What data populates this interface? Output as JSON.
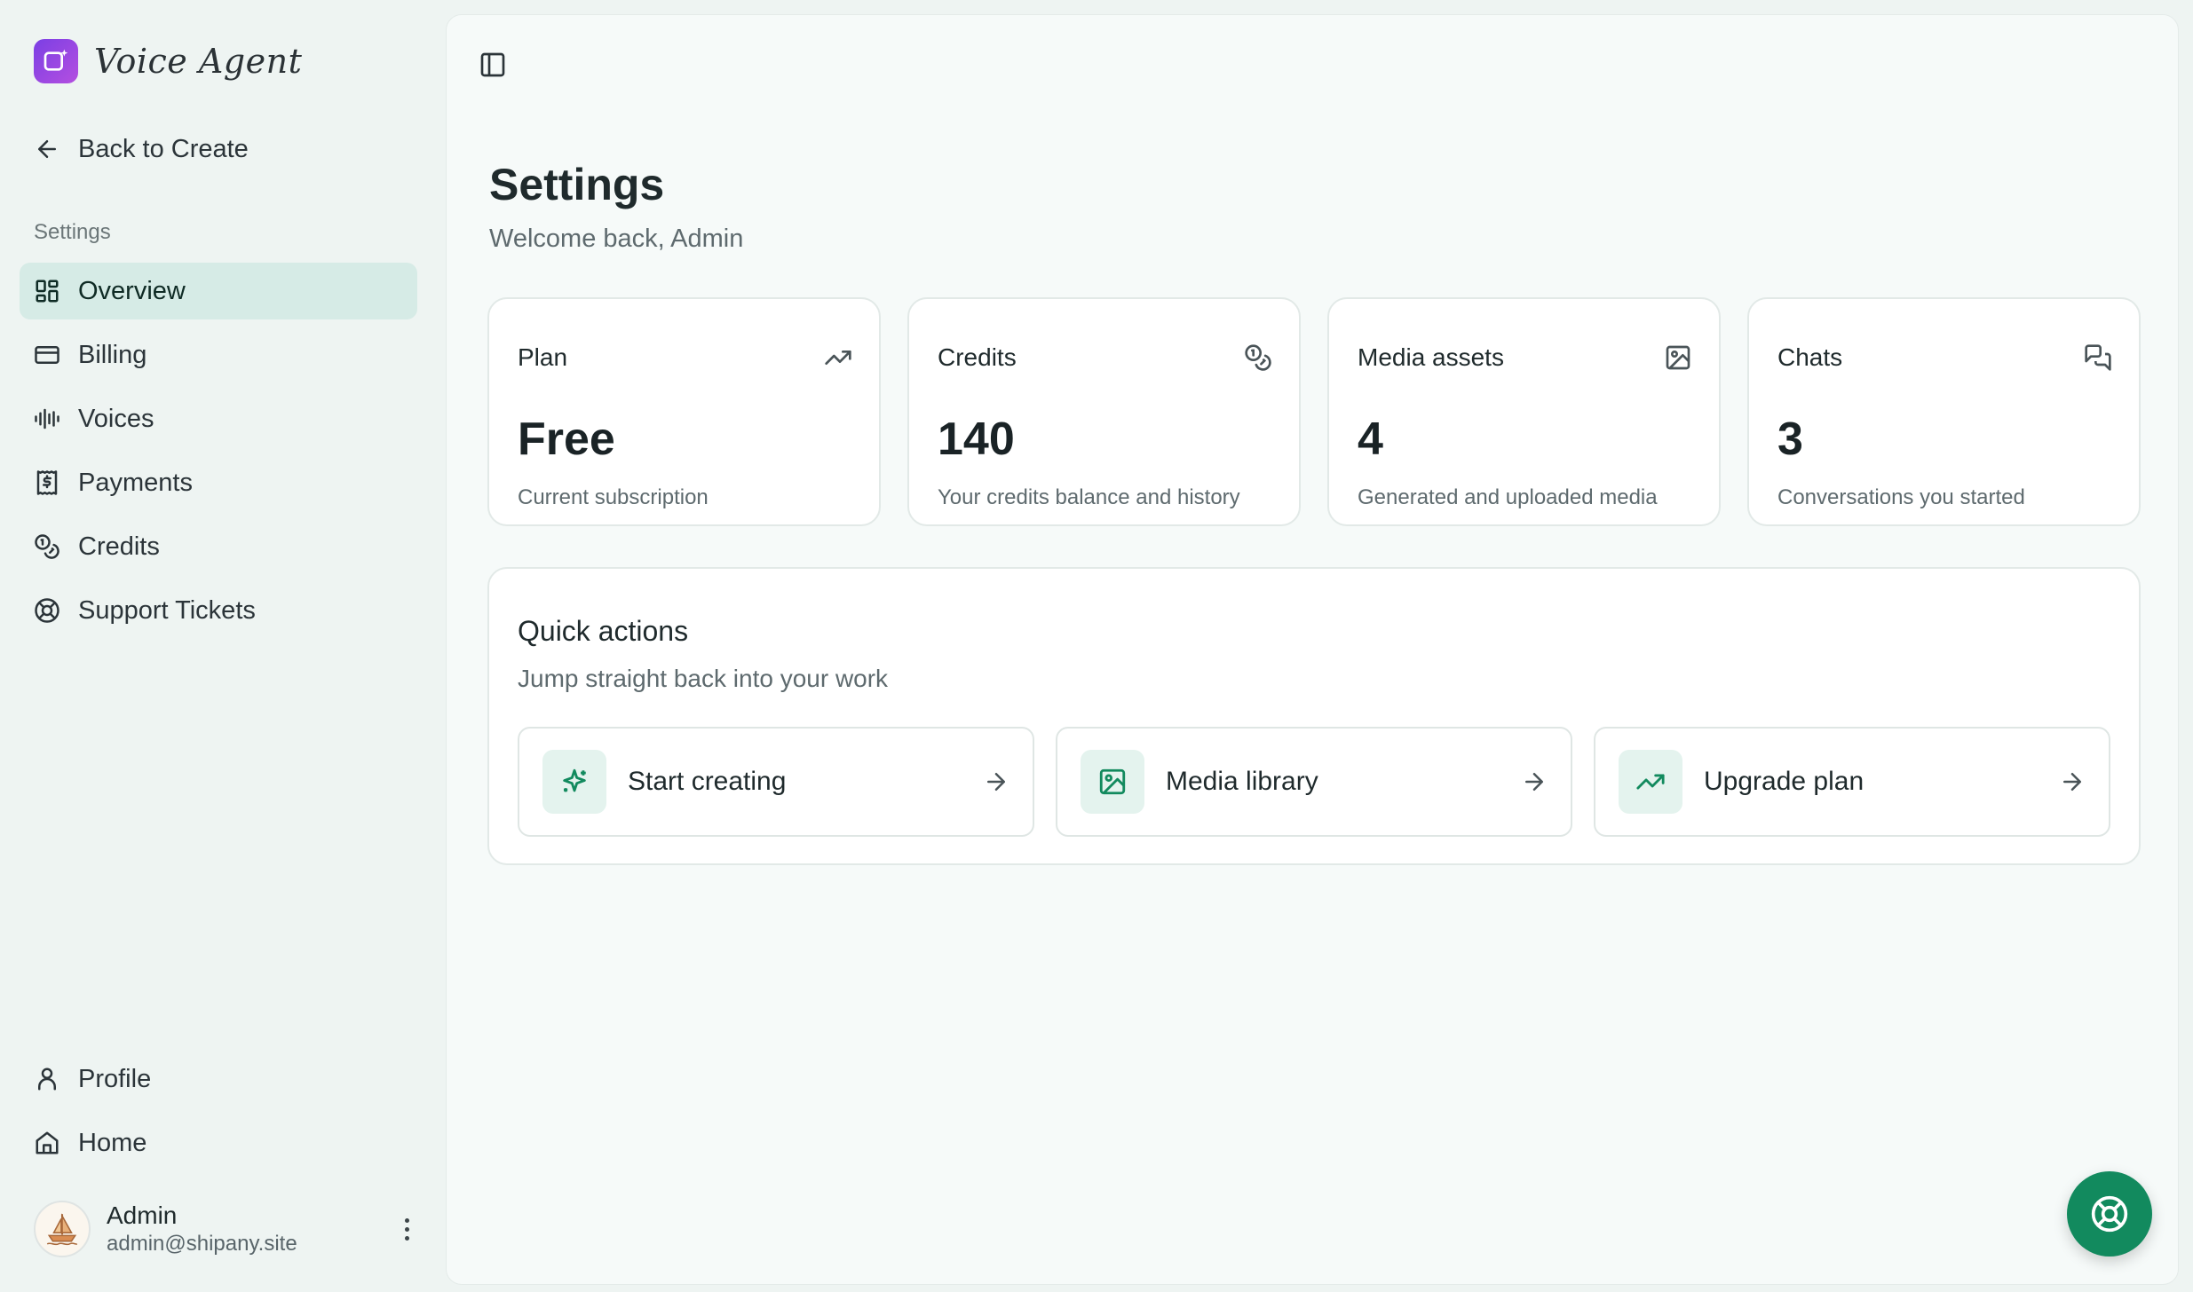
{
  "brand": {
    "name": "Voice Agent"
  },
  "back_link": {
    "label": "Back to Create"
  },
  "sidebar": {
    "section_label": "Settings",
    "items": [
      {
        "label": "Overview",
        "icon": "layout-grid-icon",
        "active": true
      },
      {
        "label": "Billing",
        "icon": "credit-card-icon"
      },
      {
        "label": "Voices",
        "icon": "audio-waveform-icon"
      },
      {
        "label": "Payments",
        "icon": "receipt-dollar-icon"
      },
      {
        "label": "Credits",
        "icon": "coins-icon"
      },
      {
        "label": "Support Tickets",
        "icon": "life-buoy-icon"
      }
    ],
    "bottom_items": [
      {
        "label": "Profile",
        "icon": "user-icon"
      },
      {
        "label": "Home",
        "icon": "home-icon"
      }
    ]
  },
  "user": {
    "name": "Admin",
    "email": "admin@shipany.site"
  },
  "header": {
    "title": "Settings",
    "subtitle": "Welcome back, Admin"
  },
  "stats": [
    {
      "title": "Plan",
      "value": "Free",
      "desc": "Current subscription",
      "icon": "trending-up-icon"
    },
    {
      "title": "Credits",
      "value": "140",
      "desc": "Your credits balance and history",
      "icon": "coins-icon"
    },
    {
      "title": "Media assets",
      "value": "4",
      "desc": "Generated and uploaded media",
      "icon": "image-icon"
    },
    {
      "title": "Chats",
      "value": "3",
      "desc": "Conversations you started",
      "icon": "messages-icon"
    }
  ],
  "quick_actions": {
    "title": "Quick actions",
    "subtitle": "Jump straight back into your work",
    "items": [
      {
        "label": "Start creating",
        "icon": "sparkles-icon"
      },
      {
        "label": "Media library",
        "icon": "image-icon"
      },
      {
        "label": "Upgrade plan",
        "icon": "trending-up-icon"
      }
    ]
  },
  "colors": {
    "accent": "#128a5e",
    "active_nav": "#d6ebe6",
    "brand_logo": "#8b45e6"
  }
}
